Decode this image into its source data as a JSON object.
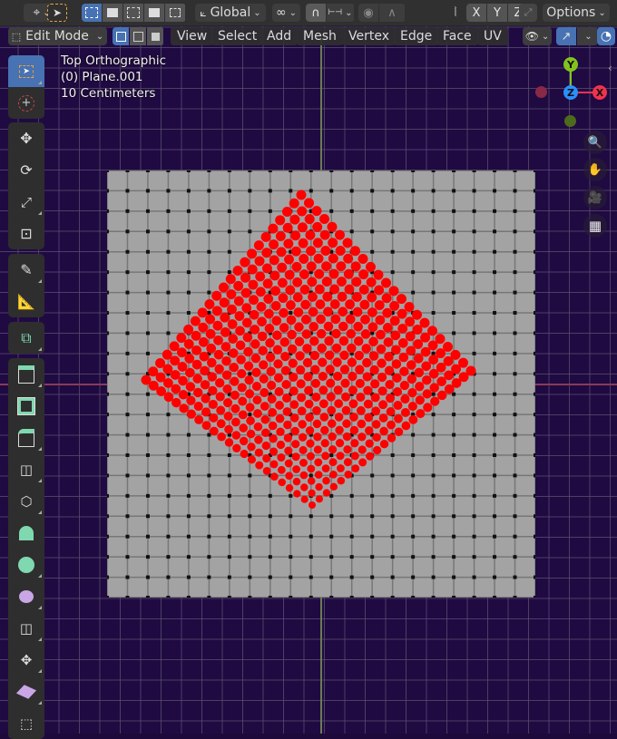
{
  "header": {
    "transform_orientation": "Global",
    "axis_x": "X",
    "axis_y": "Y",
    "axis_z": "Z",
    "options_label": "Options"
  },
  "header2": {
    "mode": "Edit Mode",
    "menus": [
      "View",
      "Select",
      "Add",
      "Mesh",
      "Vertex",
      "Edge",
      "Face",
      "UV"
    ]
  },
  "viewport": {
    "view_name": "Top Orthographic",
    "object_name": "(0) Plane.001",
    "grid_scale": "10 Centimeters"
  },
  "gizmo": {
    "y": "Y",
    "z": "Z",
    "x": "X",
    "colors": {
      "x": "#f0324f",
      "y": "#83c31e",
      "z": "#2a8fff"
    }
  },
  "toolbar": {
    "tools": [
      "select-box",
      "cursor",
      "move",
      "rotate",
      "scale",
      "transform",
      "annotate",
      "measure",
      "add-cube",
      "extrude-region",
      "inset-faces",
      "bevel",
      "loop-cut",
      "knife",
      "poly-build",
      "spin",
      "smooth",
      "edge-slide",
      "shrink-fatten",
      "shear",
      "rip-region"
    ]
  },
  "mesh": {
    "subdivisions": 21,
    "face_color": "#a3a3a3",
    "selected_vertex_color": "#ff0000"
  }
}
